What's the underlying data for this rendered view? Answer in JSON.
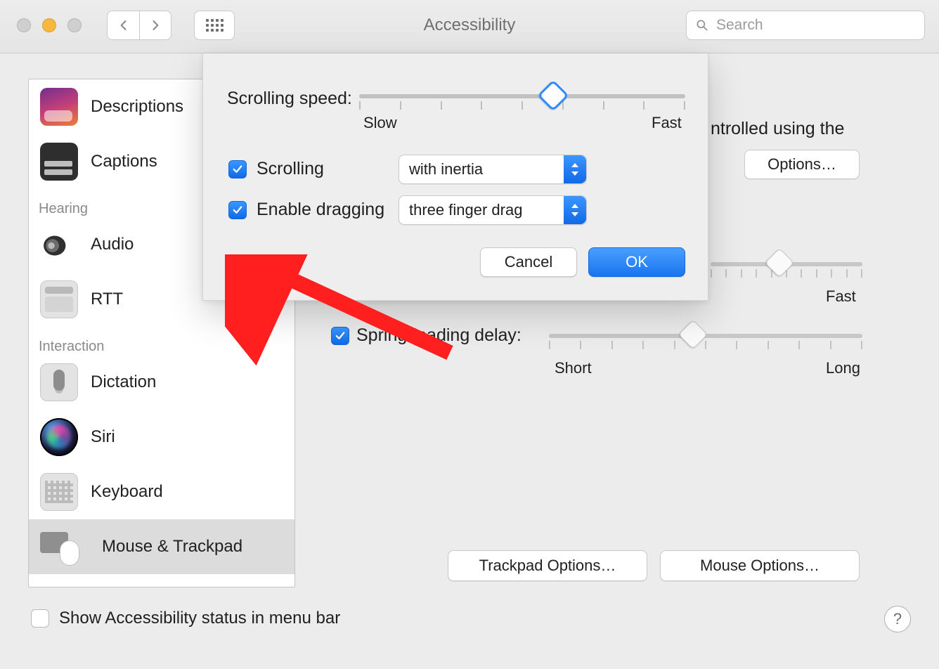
{
  "window": {
    "title": "Accessibility"
  },
  "toolbar": {
    "search_placeholder": "Search"
  },
  "sidebar": {
    "items": [
      {
        "label": "Descriptions"
      },
      {
        "label": "Captions"
      }
    ],
    "hearing_header": "Hearing",
    "hearing_items": [
      {
        "label": "Audio"
      },
      {
        "label": "RTT"
      }
    ],
    "interaction_header": "Interaction",
    "interaction_items": [
      {
        "label": "Dictation"
      },
      {
        "label": "Siri"
      },
      {
        "label": "Keyboard"
      },
      {
        "label": "Mouse & Trackpad"
      }
    ]
  },
  "main": {
    "controlled_text": "ntrolled using the",
    "options_label": "Options…",
    "double_click": {
      "fast_label": "Fast",
      "ticks": 11,
      "value_index": 5
    },
    "spring_loading": {
      "checked": true,
      "label": "Spring-loading delay:",
      "short_label": "Short",
      "long_label": "Long",
      "ticks": 11,
      "value_index": 5
    },
    "trackpad_options_label": "Trackpad Options…",
    "mouse_options_label": "Mouse Options…"
  },
  "sheet": {
    "scrolling_speed_label": "Scrolling speed:",
    "slow_label": "Slow",
    "fast_label": "Fast",
    "speed_ticks": 9,
    "speed_value_index": 5,
    "scrolling_checked": true,
    "scrolling_label": "Scrolling",
    "scrolling_mode": "with inertia",
    "dragging_checked": true,
    "dragging_label": "Enable dragging",
    "dragging_mode": "three finger drag",
    "cancel_label": "Cancel",
    "ok_label": "OK"
  },
  "footer": {
    "show_status_checked": false,
    "show_status_label": "Show Accessibility status in menu bar"
  },
  "annotation": {
    "arrow_color": "#ff1f1f"
  }
}
